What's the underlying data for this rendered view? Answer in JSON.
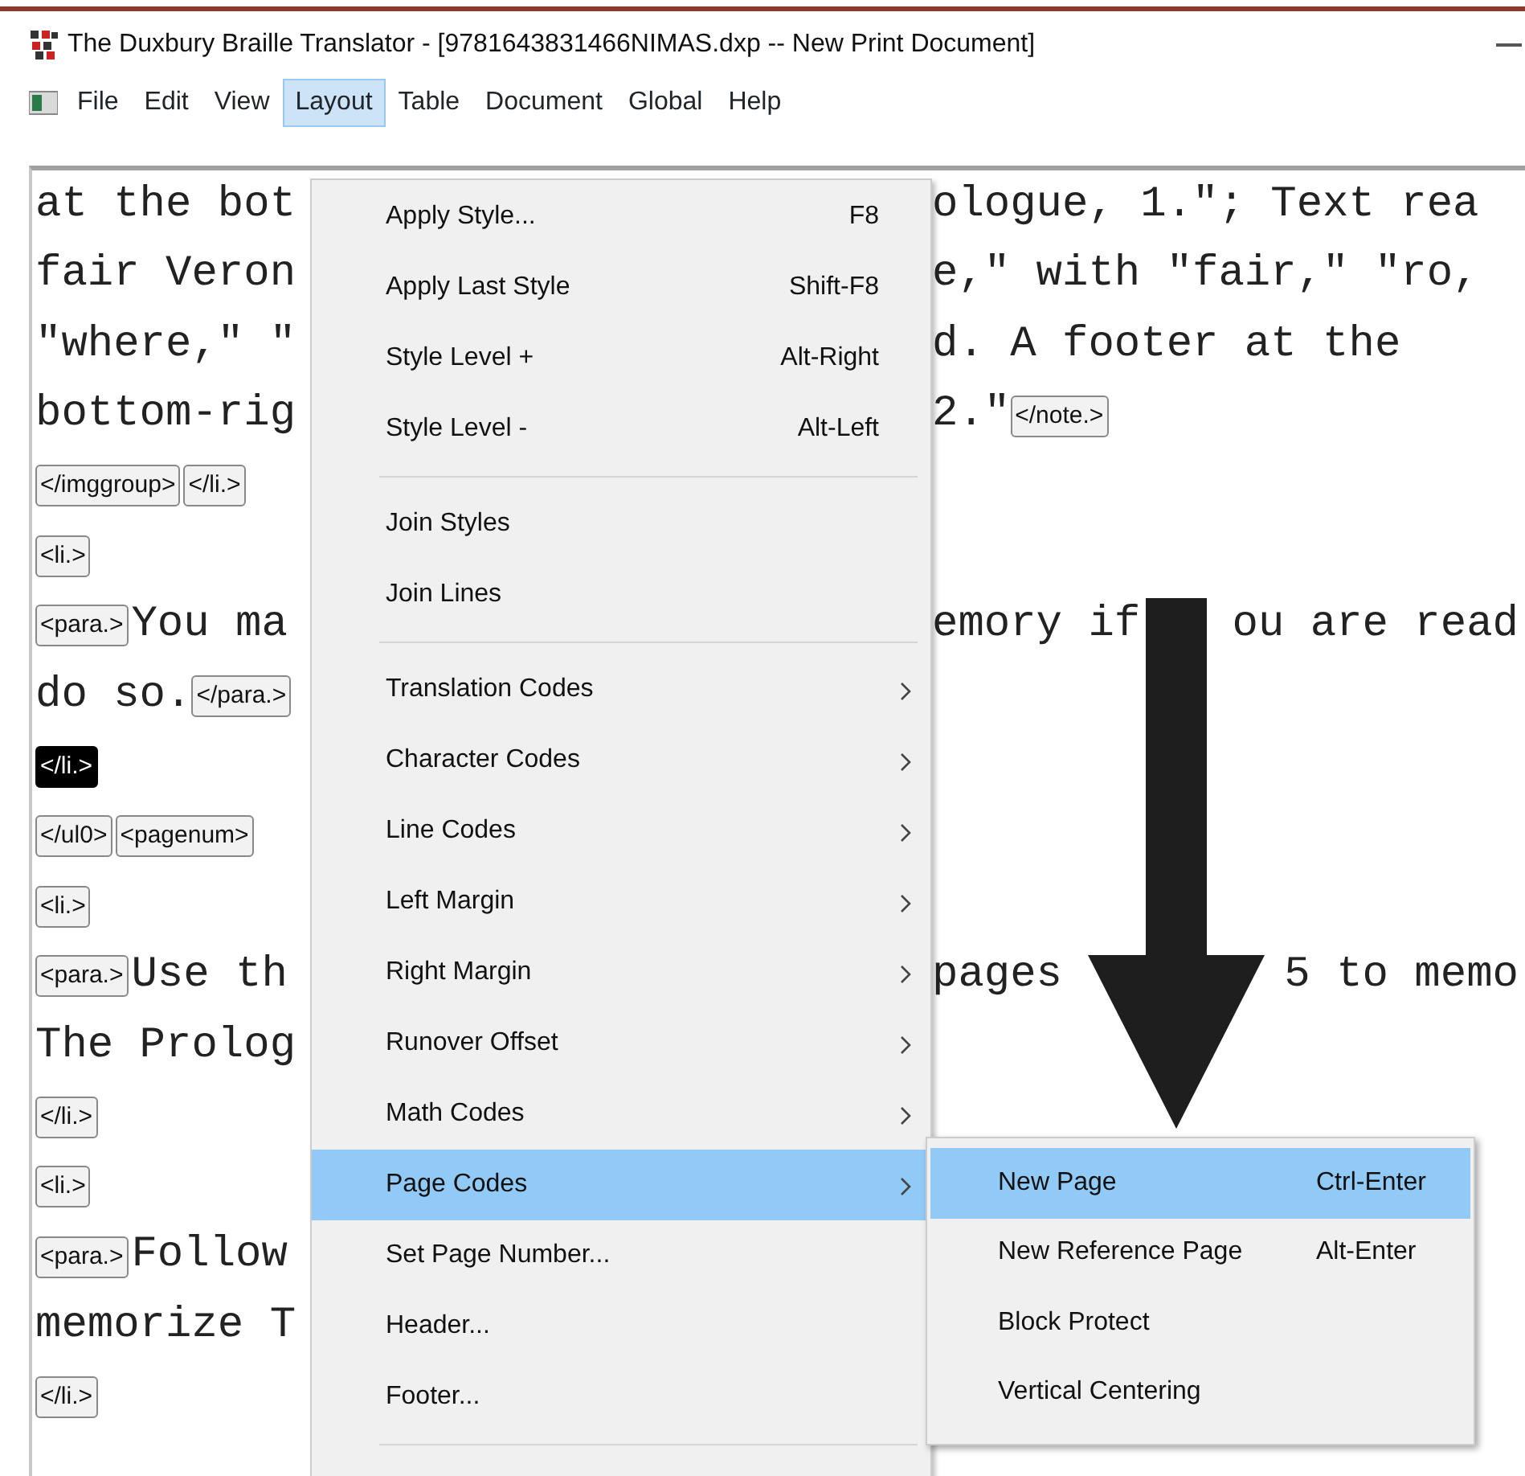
{
  "window": {
    "title": "The Duxbury Braille Translator - [9781643831466NIMAS.dxp -- New Print Document]"
  },
  "menu_bar": [
    {
      "label": "File",
      "selected": false
    },
    {
      "label": "Edit",
      "selected": false
    },
    {
      "label": "View",
      "selected": false
    },
    {
      "label": "Layout",
      "selected": true
    },
    {
      "label": "Table",
      "selected": false
    },
    {
      "label": "Document",
      "selected": false
    },
    {
      "label": "Global",
      "selected": false
    },
    {
      "label": "Help",
      "selected": false
    }
  ],
  "document": {
    "lines": [
      {
        "left": [
          {
            "kind": "text",
            "text": "at the bot"
          }
        ],
        "right": [
          "ologue, 1.\"; Text rea"
        ]
      },
      {
        "left": [
          {
            "kind": "text",
            "text": "fair Veron"
          }
        ],
        "right": [
          "e,\" with \"fair,\" \"ro,"
        ]
      },
      {
        "left": [
          {
            "kind": "text",
            "text": "\"where,\" \""
          }
        ],
        "right": [
          "d. A footer at the"
        ]
      },
      {
        "left": [
          {
            "kind": "text",
            "text": "bottom-rig"
          }
        ],
        "right": [
          "2.\""
        ],
        "right_tags": [
          {
            "text": "</note.>",
            "selected": false
          }
        ]
      },
      {
        "left": [
          {
            "kind": "tag",
            "text": "</imggroup>",
            "selected": false
          },
          {
            "kind": "tag",
            "text": "</li.>",
            "selected": false
          }
        ]
      },
      {
        "left": [
          {
            "kind": "tag",
            "text": "<li.>",
            "selected": false
          }
        ]
      },
      {
        "left": [
          {
            "kind": "tag",
            "text": "<para.>",
            "selected": false
          },
          {
            "kind": "text",
            "text": "You ma"
          }
        ],
        "right": [
          "emory if",
          "ou are read"
        ]
      },
      {
        "left": [
          {
            "kind": "text",
            "text": "do so."
          },
          {
            "kind": "tag",
            "text": "</para.>",
            "selected": false
          }
        ]
      },
      {
        "left": [
          {
            "kind": "tag",
            "text": "</li.>",
            "selected": true
          }
        ]
      },
      {
        "left": [
          {
            "kind": "tag",
            "text": "</ul0>",
            "selected": false
          },
          {
            "kind": "tag",
            "text": "<pagenum>",
            "selected": false
          }
        ]
      },
      {
        "left": [
          {
            "kind": "tag",
            "text": "<li.>",
            "selected": false
          }
        ]
      },
      {
        "left": [
          {
            "kind": "tag",
            "text": "<para.>",
            "selected": false
          },
          {
            "kind": "text",
            "text": "Use th"
          }
        ],
        "right": [
          "pages",
          "5 to memo"
        ]
      },
      {
        "left": [
          {
            "kind": "text",
            "text": "The Prolog"
          }
        ]
      },
      {
        "left": [
          {
            "kind": "tag",
            "text": "</li.>",
            "selected": false
          }
        ]
      },
      {
        "left": [
          {
            "kind": "tag",
            "text": "<li.>",
            "selected": false
          }
        ]
      },
      {
        "left": [
          {
            "kind": "tag",
            "text": "<para.>",
            "selected": false
          },
          {
            "kind": "text",
            "text": "Follow"
          }
        ]
      },
      {
        "left": [
          {
            "kind": "text",
            "text": "memorize T"
          }
        ]
      },
      {
        "left": [
          {
            "kind": "tag",
            "text": "</li.>",
            "selected": false
          }
        ]
      }
    ]
  },
  "menu": {
    "items": [
      {
        "kind": "item",
        "label": "Apply Style...",
        "shortcut": "F8",
        "submenu": false,
        "selected": false
      },
      {
        "kind": "item",
        "label": "Apply Last Style",
        "shortcut": "Shift-F8",
        "submenu": false,
        "selected": false
      },
      {
        "kind": "item",
        "label": "Style Level +",
        "shortcut": "Alt-Right",
        "submenu": false,
        "selected": false
      },
      {
        "kind": "item",
        "label": "Style Level -",
        "shortcut": "Alt-Left",
        "submenu": false,
        "selected": false
      },
      {
        "kind": "separator"
      },
      {
        "kind": "item",
        "label": "Join Styles",
        "submenu": false,
        "selected": false
      },
      {
        "kind": "item",
        "label": "Join Lines",
        "submenu": false,
        "selected": false
      },
      {
        "kind": "separator"
      },
      {
        "kind": "item",
        "label": "Translation Codes",
        "submenu": true,
        "selected": false
      },
      {
        "kind": "item",
        "label": "Character Codes",
        "submenu": true,
        "selected": false
      },
      {
        "kind": "item",
        "label": "Line Codes",
        "submenu": true,
        "selected": false
      },
      {
        "kind": "item",
        "label": "Left Margin",
        "submenu": true,
        "selected": false
      },
      {
        "kind": "item",
        "label": "Right Margin",
        "submenu": true,
        "selected": false
      },
      {
        "kind": "item",
        "label": "Runover Offset",
        "submenu": true,
        "selected": false
      },
      {
        "kind": "item",
        "label": "Math Codes",
        "submenu": true,
        "selected": false
      },
      {
        "kind": "item",
        "label": "Page Codes",
        "submenu": true,
        "selected": true
      },
      {
        "kind": "item",
        "label": "Set Page Number...",
        "submenu": false,
        "selected": false
      },
      {
        "kind": "item",
        "label": "Header...",
        "submenu": false,
        "selected": false
      },
      {
        "kind": "item",
        "label": "Footer...",
        "submenu": false,
        "selected": false
      },
      {
        "kind": "separator"
      }
    ]
  },
  "submenu": {
    "items": [
      {
        "label": "New Page",
        "shortcut": "Ctrl-Enter",
        "selected": true
      },
      {
        "label": "New Reference Page",
        "shortcut": "Alt-Enter",
        "selected": false
      },
      {
        "label": "Block Protect",
        "selected": false
      },
      {
        "label": "Vertical Centering",
        "selected": false
      }
    ]
  }
}
